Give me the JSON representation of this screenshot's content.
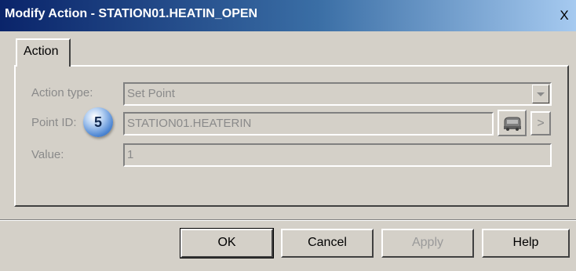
{
  "dialog": {
    "title": "Modify Action - STATION01.HEATIN_OPEN",
    "close_label": "X"
  },
  "tabs": [
    {
      "label": "Action"
    }
  ],
  "form": {
    "action_type": {
      "label": "Action type:",
      "value": "Set Point"
    },
    "point_id": {
      "label": "Point ID:",
      "value": "STATION01.HEATERIN",
      "browse_label": ">"
    },
    "value": {
      "label": "Value:",
      "value": "1"
    }
  },
  "callout": {
    "number": "5"
  },
  "buttons": {
    "ok": "OK",
    "cancel": "Cancel",
    "apply": "Apply",
    "help": "Help"
  },
  "colors": {
    "titlebar_start": "#0a246a",
    "titlebar_end": "#a6caf0",
    "face": "#d4d0c8",
    "disabled_text": "#8a8a8a",
    "callout": "#4d86d3"
  }
}
